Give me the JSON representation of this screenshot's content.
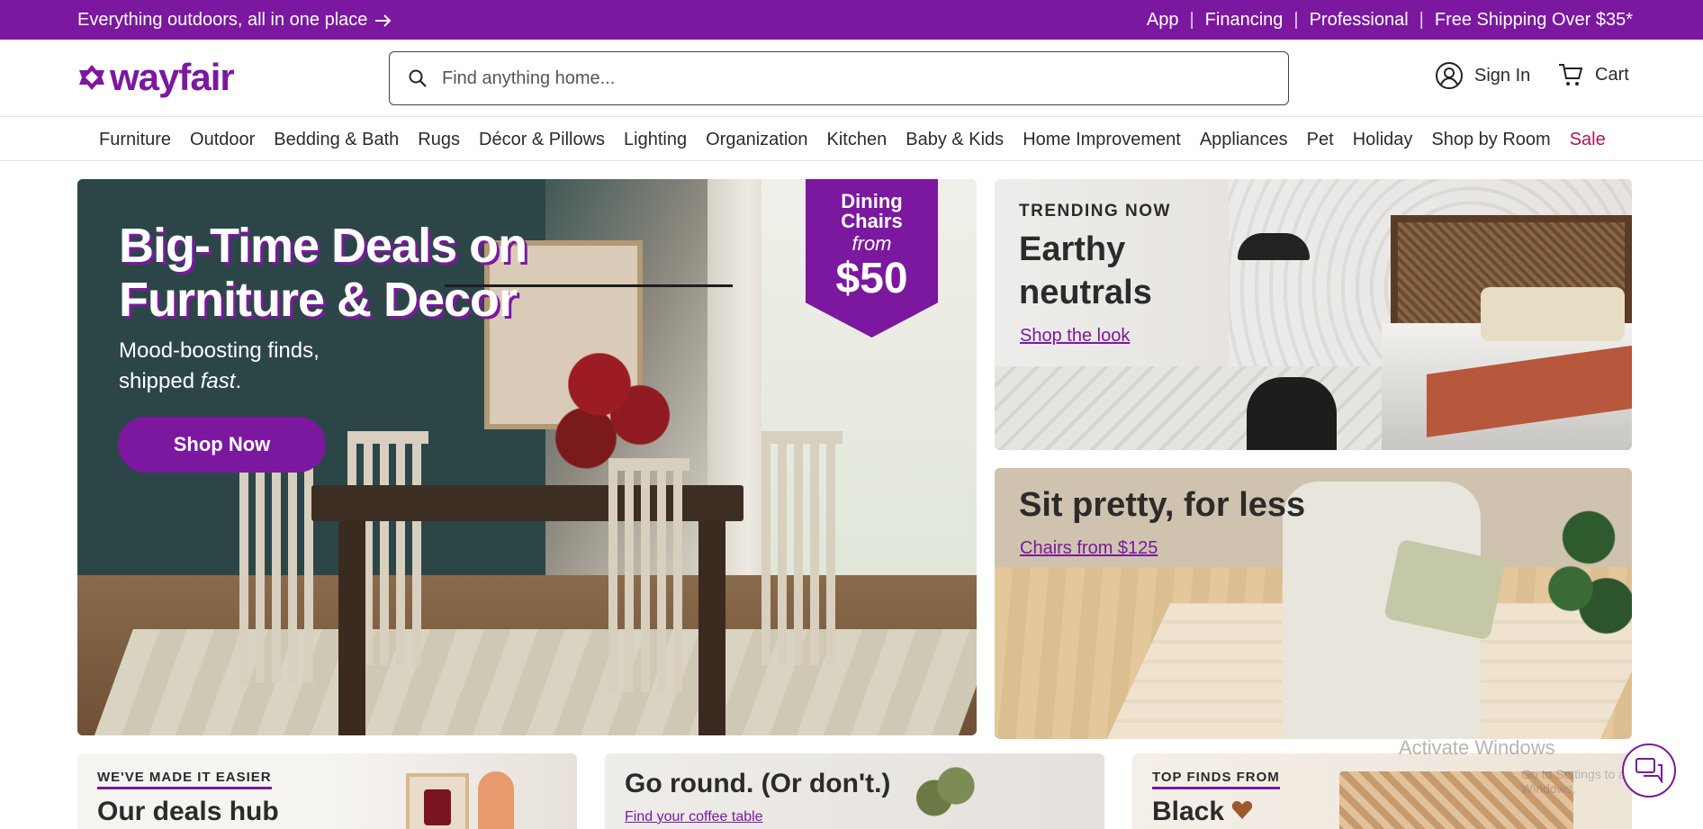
{
  "promo": {
    "left_text": "Everything outdoors, all in one place",
    "right_links": [
      "App",
      "Financing",
      "Professional",
      "Free Shipping Over $35*"
    ]
  },
  "header": {
    "logo_text": "wayfair",
    "search_placeholder": "Find anything home...",
    "sign_in": "Sign In",
    "cart": "Cart"
  },
  "nav": {
    "items": [
      "Furniture",
      "Outdoor",
      "Bedding & Bath",
      "Rugs",
      "Décor & Pillows",
      "Lighting",
      "Organization",
      "Kitchen",
      "Baby & Kids",
      "Home Improvement",
      "Appliances",
      "Pet",
      "Holiday",
      "Shop by Room",
      "Sale"
    ]
  },
  "hero": {
    "title_line1": "Big-Time Deals on",
    "title_line2": "Furniture & Decor",
    "subtitle_line1": "Mood-boosting finds,",
    "subtitle_line2_pre": "shipped ",
    "subtitle_line2_em": "fast",
    "subtitle_line2_post": ".",
    "button": "Shop Now",
    "badge": {
      "line1": "Dining",
      "line2": "Chairs",
      "line3": "from",
      "price": "$50"
    }
  },
  "cards": {
    "trending": {
      "eyebrow": "TRENDING NOW",
      "title_line1": "Earthy",
      "title_line2": "neutrals",
      "link": "Shop the look"
    },
    "sit_pretty": {
      "title": "Sit pretty, for less",
      "link": "Chairs from $125"
    }
  },
  "bottom": {
    "b1": {
      "eyebrow": "WE'VE MADE IT EASIER",
      "title": "Our deals hub"
    },
    "b2": {
      "title": "Go round. (Or don't.)",
      "link": "Find your coffee table"
    },
    "b3": {
      "eyebrow": "TOP FINDS FROM",
      "title": "Black"
    }
  },
  "overlay": {
    "activate_title": "Activate Windows",
    "activate_sub": "Go to Settings to activate Windows."
  },
  "colors": {
    "brand": "#7b189f",
    "sale": "#a8185b"
  }
}
